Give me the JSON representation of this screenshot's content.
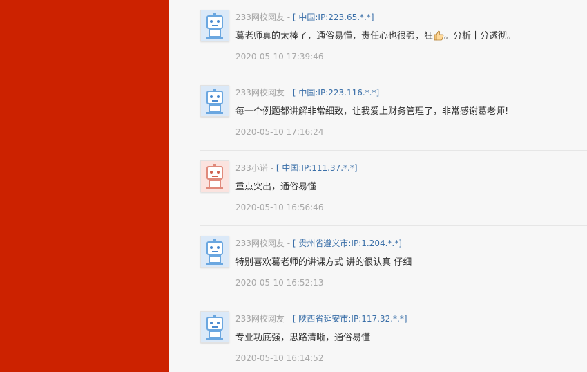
{
  "colors": {
    "red_panel": "#cc2200",
    "ip_link": "#3a6fa8",
    "avatar_blue": "#6ba7e0",
    "avatar_red": "#e08a7c"
  },
  "comments": [
    {
      "user": "233网校网友",
      "separator": " - ",
      "location": "[ 中国:IP:223.65.*.*]",
      "text": "葛老师真的太棒了，通俗易懂，责任心也很强，狂",
      "emoji": "thumbs-up-icon",
      "text_after": "。分析十分透彻。",
      "time": "2020-05-10 17:39:46",
      "avatar": "robot-blue"
    },
    {
      "user": "233网校网友",
      "separator": " - ",
      "location": "[ 中国:IP:223.116.*.*]",
      "text": "每一个例题都讲解非常细致，让我爱上财务管理了，非常感谢葛老师!",
      "time": "2020-05-10 17:16:24",
      "avatar": "robot-blue"
    },
    {
      "user": "233小诺",
      "separator": " - ",
      "location": "[ 中国:IP:111.37.*.*]",
      "text": "重点突出，通俗易懂",
      "time": "2020-05-10 16:56:46",
      "avatar": "robot-red"
    },
    {
      "user": "233网校网友",
      "separator": " - ",
      "location": "[ 贵州省遵义市:IP:1.204.*.*]",
      "text": "特别喜欢葛老师的讲课方式 讲的很认真 仔细",
      "time": "2020-05-10 16:52:13",
      "avatar": "robot-blue"
    },
    {
      "user": "233网校网友",
      "separator": " - ",
      "location": "[ 陕西省延安市:IP:117.32.*.*]",
      "text": "专业功底强，思路清晰，通俗易懂",
      "time": "2020-05-10 16:14:52",
      "avatar": "robot-blue"
    }
  ]
}
